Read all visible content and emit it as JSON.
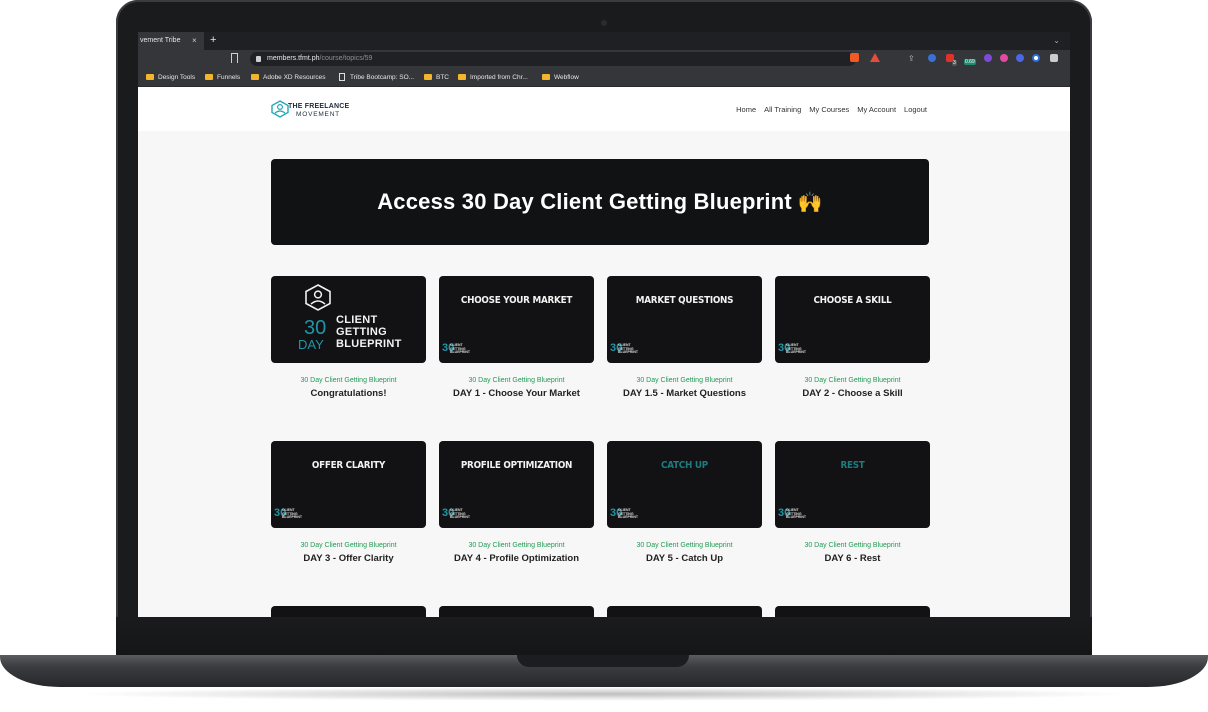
{
  "browser": {
    "tab_title": "vement Tribe",
    "tab_close": "×",
    "new_tab": "+",
    "tab_menu": "⌄",
    "url_host": "members.tfmt.ph",
    "url_path": "/course/topics/59",
    "extension_badge_1": "3",
    "extension_badge_2": "0.69",
    "bookmarks": [
      {
        "label": "Design Tools",
        "icon": "folder-icon"
      },
      {
        "label": "Funnels",
        "icon": "folder-icon"
      },
      {
        "label": "Adobe XD Resources",
        "icon": "folder-icon"
      },
      {
        "label": "Tribe Bootcamp: SO...",
        "icon": "page-icon"
      },
      {
        "label": "BTC",
        "icon": "folder-icon"
      },
      {
        "label": "Imported from Chr...",
        "icon": "folder-icon"
      },
      {
        "label": "Webflow",
        "icon": "folder-icon"
      }
    ]
  },
  "site": {
    "logo_line1": "THE FREELANCE",
    "logo_line2": "MOVEMENT",
    "nav": [
      "Home",
      "All Training",
      "My Courses",
      "My Account",
      "Logout"
    ]
  },
  "hero": {
    "title": "Access 30 Day Client Getting Blueprint",
    "emoji": "🙌"
  },
  "thumb_brand": {
    "big_number": "30",
    "big_day": "DAY",
    "big_words": [
      "CLIENT",
      "GETTING",
      "BLUEPRINT"
    ],
    "mini_number": "30",
    "mini_words": [
      "CLIENT",
      "GETTING",
      "BLUEPRINT"
    ]
  },
  "cards": [
    {
      "thumb_title": "",
      "course": "30 Day Client Getting Blueprint",
      "title": "Congratulations!"
    },
    {
      "thumb_title": "CHOOSE YOUR MARKET",
      "course": "30 Day Client Getting Blueprint",
      "title": "DAY 1 - Choose Your Market"
    },
    {
      "thumb_title": "MARKET QUESTIONS",
      "course": "30 Day Client Getting Blueprint",
      "title": "DAY 1.5 - Market Questions"
    },
    {
      "thumb_title": "CHOOSE A SKILL",
      "course": "30 Day Client Getting Blueprint",
      "title": "DAY 2 - Choose a Skill"
    },
    {
      "thumb_title": "OFFER CLARITY",
      "course": "30 Day Client Getting Blueprint",
      "title": "DAY 3 - Offer Clarity"
    },
    {
      "thumb_title": "PROFILE OPTIMIZATION",
      "course": "30 Day Client Getting Blueprint",
      "title": "DAY 4 - Profile Optimization"
    },
    {
      "thumb_title": "CATCH UP",
      "course": "30 Day Client Getting Blueprint",
      "title": "DAY 5 - Catch Up"
    },
    {
      "thumb_title": "REST",
      "course": "30 Day Client Getting Blueprint",
      "title": "DAY 6 - Rest"
    }
  ],
  "colors": {
    "course_label": "#219a55",
    "brand_teal": "#1f95a6",
    "thumb_bg": "#121214"
  }
}
